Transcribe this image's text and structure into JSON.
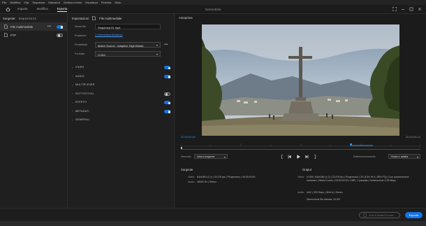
{
  "menu": [
    "File",
    "Modifica",
    "Clip",
    "Sequenza",
    "Marcatori",
    "Grafica e testo",
    "Visualizza",
    "Finestra",
    "Aiuto"
  ],
  "workspace_tabs": [
    {
      "label": "Importa"
    },
    {
      "label": "Modifica"
    },
    {
      "label": "Esporta"
    }
  ],
  "document_title": "Senza titolo",
  "icons": {
    "home": "home-icon",
    "fullscreen": "fullscreen-icon",
    "minimize": "minimize-icon",
    "maximize": "maximize-icon",
    "close": "close-icon",
    "file": "file-icon",
    "media_encoder": "media-encoder-icon"
  },
  "source_panel": {
    "label": "Sorgente:",
    "sequence": "Sequenza 01",
    "more": "•••",
    "destinations": [
      {
        "label": "File multimediale",
        "enabled": true
      },
      {
        "label": "FTP",
        "enabled": false
      }
    ]
  },
  "settings": {
    "header": "Impostazioni",
    "header_file": "File multimediale",
    "file_name_label": "Nome file",
    "file_name": "Sequenza 01.mp4",
    "location_label": "Posizione",
    "location": "C:\\Users\\Acer\\Desktop\\",
    "preset_label": "Predefinito",
    "preset": "Match Source - Adaptive High Bitrate",
    "format_label": "Formato",
    "format": "H.264",
    "more": "•••",
    "sections": [
      {
        "name": "VIDEO",
        "toggle": true
      },
      {
        "name": "AUDIO",
        "toggle": true
      },
      {
        "name": "MULTIPLEXER",
        "toggle": null
      },
      {
        "name": "SOTTOTITOLI",
        "toggle": false
      },
      {
        "name": "EFFETTI",
        "toggle": true
      },
      {
        "name": "METADATI",
        "toggle": true
      },
      {
        "name": "GENERALI",
        "toggle": null
      }
    ]
  },
  "preview": {
    "title": "Anteprima",
    "timecode_start": "00;00;00;00",
    "timecode_end": "00;00;05;13",
    "range_label": "Intervallo",
    "range_value": "Intera sorgente",
    "scale_label": "Ridimensionamento",
    "scale_value": "Scala e adatta"
  },
  "source_info": {
    "title": "Sorgente",
    "rows": [
      {
        "k": "Video:",
        "v": "640x360 (1,0) | 23,976 fps | Progressivo | 00;00;00;00"
      },
      {
        "k": "Audio:",
        "v": "48000 Hz | Stereo"
      }
    ]
  },
  "output_info": {
    "title": "Output",
    "rows": [
      {
        "k": "Video:",
        "v": "H.264 | 640x360 (1,0) | 23,976 fps | Progressivo | 2D (10% HLS, 98% PQ) | Con accelerazione hardware | Media Codec | 00:00:00:00 | VBR | 1 passata | Destinazione 0,25 Mbps"
      },
      {
        "k": "Audio:",
        "v": "AAC | 320 Kbps | 48 kHz | Stereo"
      },
      {
        "k": "",
        "v": "Dimensione file stimata:  24 KB"
      }
    ]
  },
  "footer": {
    "queue_button": "Invia a Media Encoder",
    "export_button": "Esporta"
  },
  "colors": {
    "accent": "#1473e6",
    "link": "#4a9df8",
    "timecode": "#2d8ceb"
  }
}
